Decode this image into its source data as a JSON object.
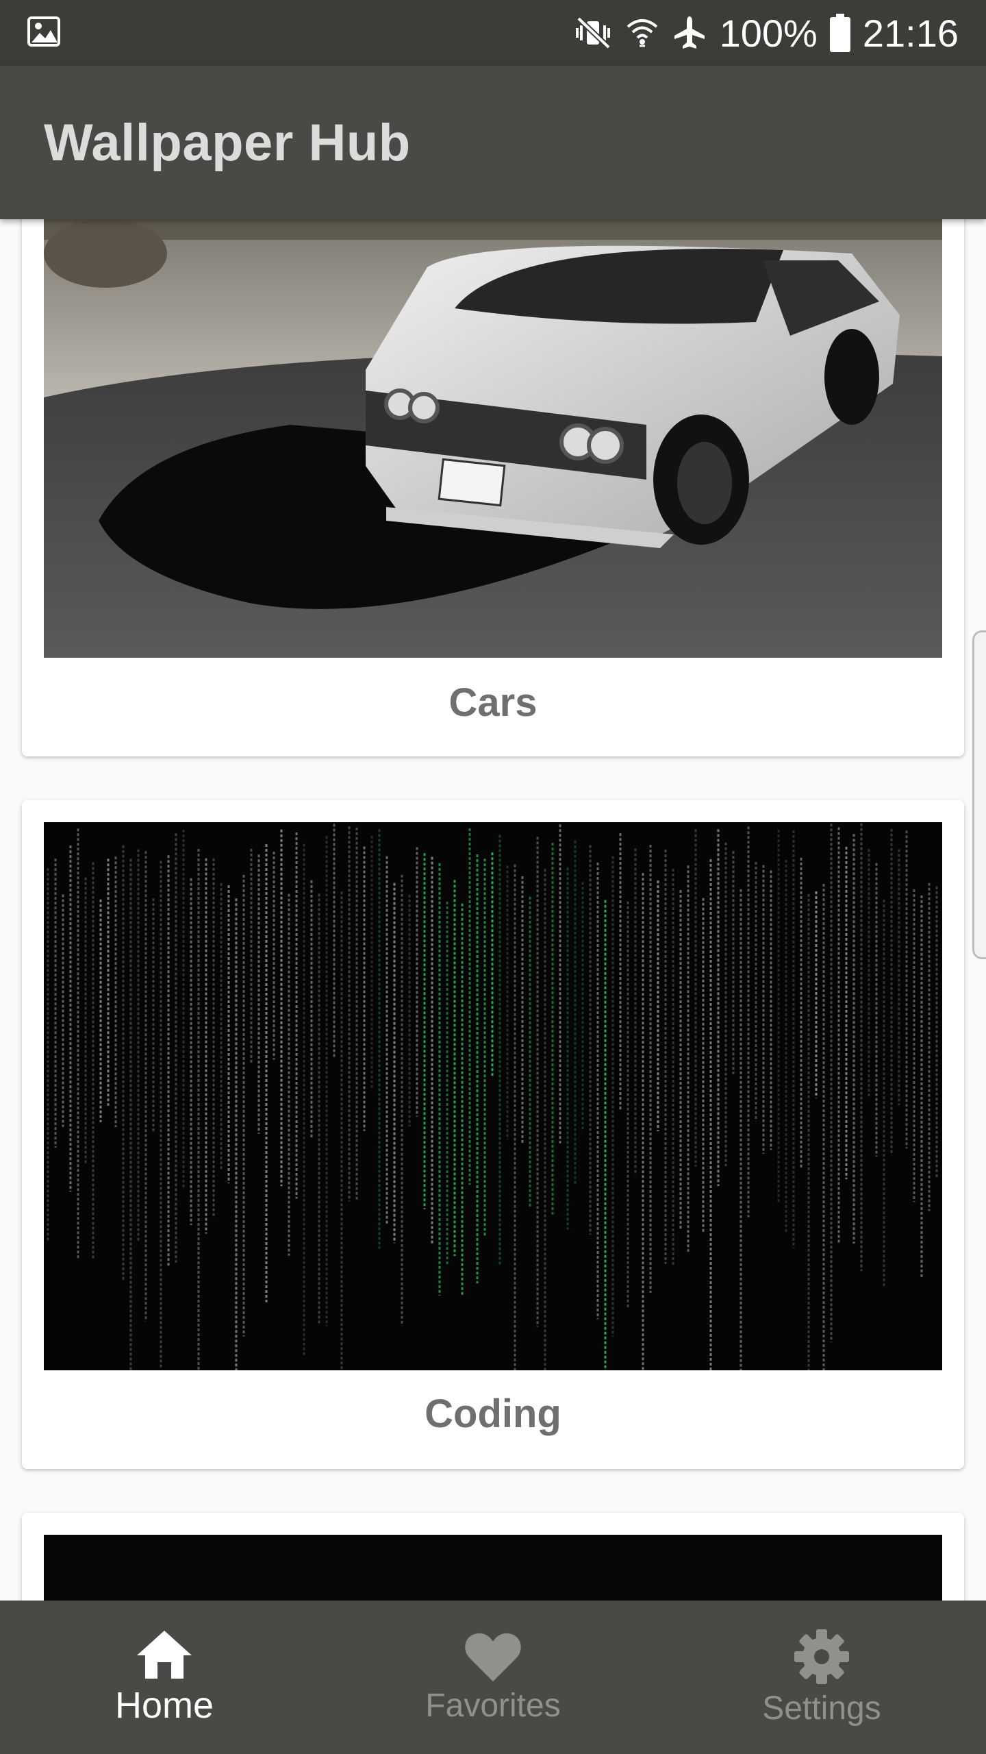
{
  "status_bar": {
    "battery_text": "100%",
    "time": "21:16"
  },
  "app_bar": {
    "title": "Wallpaper Hub"
  },
  "cards": [
    {
      "label": "Cars"
    },
    {
      "label": "Coding"
    }
  ],
  "bottom_nav": {
    "items": [
      {
        "label": "Home",
        "icon": "home-icon",
        "active": true
      },
      {
        "label": "Favorites",
        "icon": "heart-icon",
        "active": false
      },
      {
        "label": "Settings",
        "icon": "gear-icon",
        "active": false
      }
    ]
  },
  "colors": {
    "status_bar": "#3b3d39",
    "app_bar": "#484a45",
    "nav_active": "#ffffff",
    "nav_inactive": "#8f918c",
    "matrix_green": "#2ecc60"
  }
}
